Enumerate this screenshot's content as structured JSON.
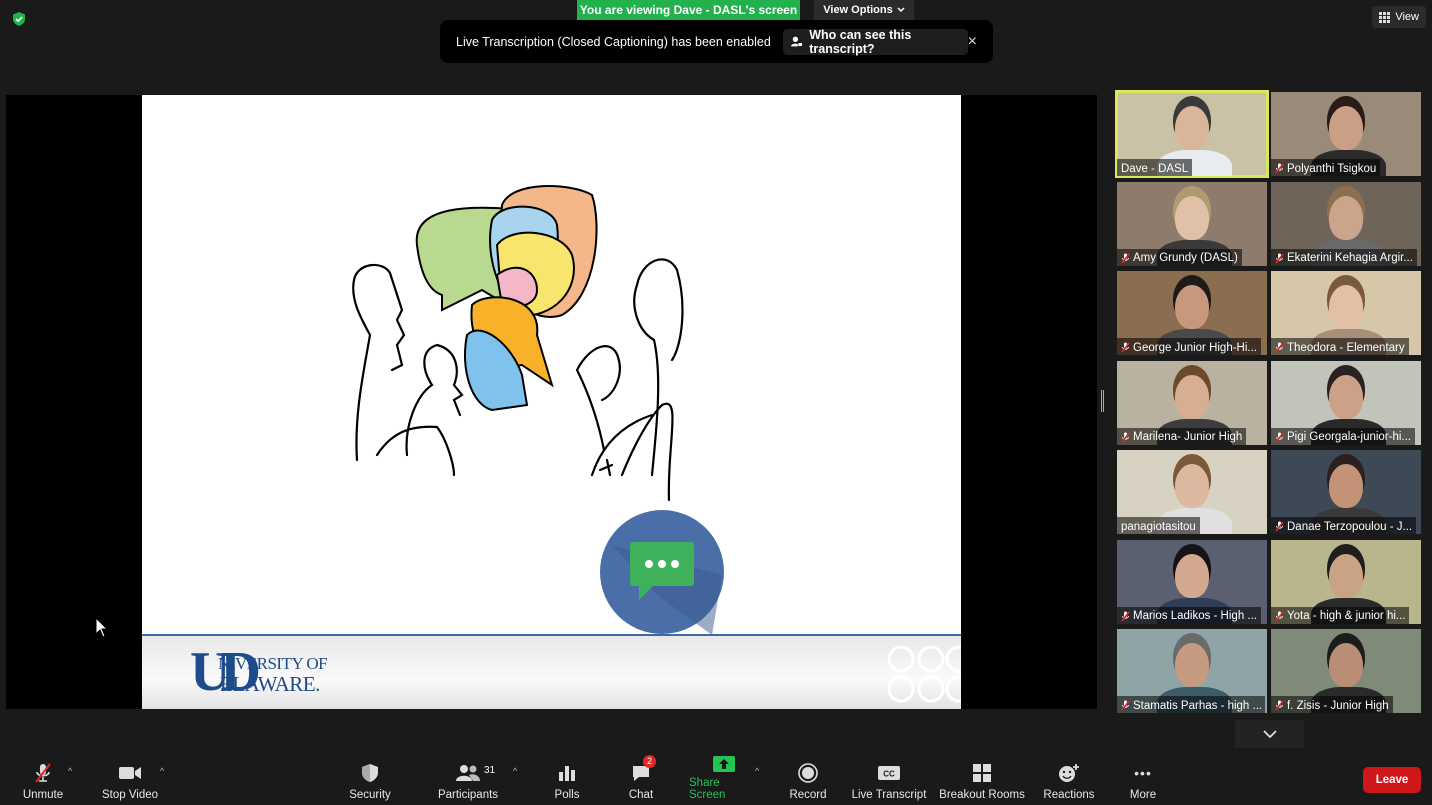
{
  "top": {
    "viewing_text": "You are viewing Dave - DASL's screen",
    "view_options_label": "View Options",
    "view_label": "View"
  },
  "banner": {
    "message": "Live Transcription (Closed Captioning) has been enabled",
    "who_label": "Who can see this transcript?",
    "close_symbol": "×"
  },
  "slide": {
    "logo_line1": "NIVERSITY OF",
    "logo_line2": "ELAWARE.",
    "logo_mark": "UD"
  },
  "participants": [
    {
      "name": "Dave - DASL",
      "muted": false,
      "active": true
    },
    {
      "name": "Polyanthi Tsigkou",
      "muted": true
    },
    {
      "name": "Amy Grundy (DASL)",
      "muted": true
    },
    {
      "name": "Ekaterini Kehagia Argir...",
      "muted": true
    },
    {
      "name": "George Junior High-Hi...",
      "muted": true
    },
    {
      "name": "Theodora - Elementary",
      "muted": true
    },
    {
      "name": "Marilena- Junior High",
      "muted": true
    },
    {
      "name": "Pigi Georgala-junior-hi...",
      "muted": true
    },
    {
      "name": "panagiotasitou",
      "muted": false
    },
    {
      "name": "Danae Terzopoulou - J...",
      "muted": true
    },
    {
      "name": "Marios Ladikos - High ...",
      "muted": true
    },
    {
      "name": "Yota - high & junior hi...",
      "muted": true
    },
    {
      "name": "Stamatis Parhas - high ...",
      "muted": true
    },
    {
      "name": "f. Zisis - Junior High",
      "muted": true
    }
  ],
  "toolbar": {
    "unmute": "Unmute",
    "stop_video": "Stop Video",
    "security": "Security",
    "participants": "Participants",
    "participants_count": "31",
    "polls": "Polls",
    "chat": "Chat",
    "chat_badge": "2",
    "share_screen": "Share Screen",
    "record": "Record",
    "live_transcript": "Live Transcript",
    "breakout_rooms": "Breakout Rooms",
    "reactions": "Reactions",
    "more": "More",
    "leave": "Leave",
    "cc": "CC",
    "more_dots": "•••"
  },
  "colors": {
    "share_green": "#23b14d",
    "leave_red": "#d0181b",
    "active_speaker": "#d8e85a"
  }
}
